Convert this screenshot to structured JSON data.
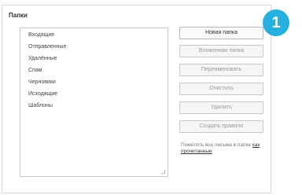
{
  "panel": {
    "title": "Папки"
  },
  "folders": [
    {
      "name": "Входящие",
      "count": ""
    },
    {
      "name": "Отправленные",
      "count": ""
    },
    {
      "name": "Удалённые",
      "count": ""
    },
    {
      "name": "Спам",
      "count": ""
    },
    {
      "name": "Черновики",
      "count": ""
    },
    {
      "name": "Исходящие",
      "count": ""
    },
    {
      "name": "Шаблоны",
      "count": ""
    }
  ],
  "buttons": {
    "new_folder": "Новая папка",
    "subfolder": "Вложенная папка",
    "rename": "Переименовать",
    "clear": "Очистить",
    "delete": "Удалить",
    "create_rule": "Создать правило"
  },
  "hint": {
    "text": "Пометить все письма в папке",
    "link": "как прочитанные"
  },
  "badge": {
    "number": "1"
  },
  "colors": {
    "badge": "#25b0e0"
  }
}
